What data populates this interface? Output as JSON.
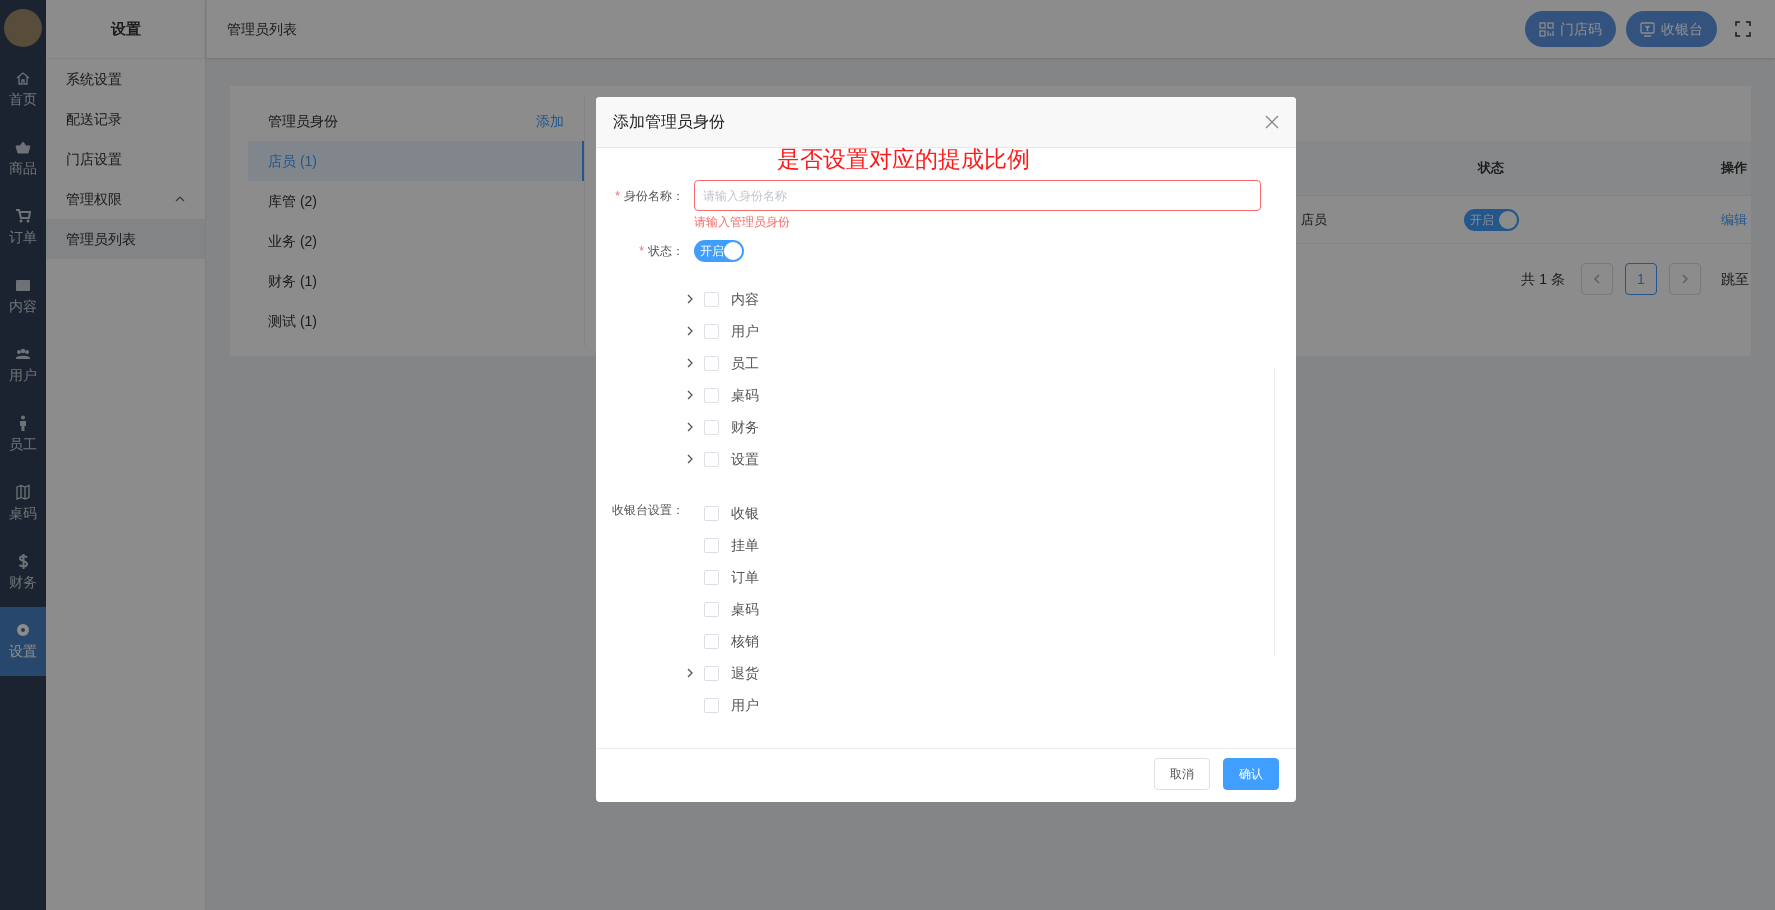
{
  "nav_rail": {
    "items": [
      {
        "label": "首页",
        "selected": false
      },
      {
        "label": "商品",
        "selected": false
      },
      {
        "label": "订单",
        "selected": false
      },
      {
        "label": "内容",
        "selected": false
      },
      {
        "label": "用户",
        "selected": false
      },
      {
        "label": "员工",
        "selected": false
      },
      {
        "label": "桌码",
        "selected": false
      },
      {
        "label": "财务",
        "selected": false
      },
      {
        "label": "设置",
        "selected": true
      }
    ]
  },
  "submenu": {
    "title": "设置",
    "items": [
      {
        "label": "系统设置"
      },
      {
        "label": "配送记录"
      },
      {
        "label": "门店设置"
      },
      {
        "label": "管理权限",
        "expanded": true,
        "children": [
          {
            "label": "管理员列表",
            "selected": true
          }
        ]
      }
    ]
  },
  "header": {
    "breadcrumb": "管理员列表",
    "buttons": [
      "门店码",
      "收银台"
    ]
  },
  "roles": {
    "title": "管理员身份",
    "add": "添加",
    "items": [
      {
        "label": "店员 (1)",
        "selected": true
      },
      {
        "label": "库管 (2)",
        "selected": false
      },
      {
        "label": "业务 (2)",
        "selected": false
      },
      {
        "label": "财务 (1)",
        "selected": false
      },
      {
        "label": "测试 (1)",
        "selected": false
      }
    ]
  },
  "table": {
    "columns": [
      "状态",
      "操作"
    ],
    "rows": [
      {
        "column_1": "店员",
        "status": {
          "label": "开启",
          "on": true
        },
        "action": "编辑"
      }
    ]
  },
  "pagination": {
    "total": "共 1 条",
    "pages": [
      {
        "label": "1",
        "selected": true
      }
    ],
    "jump": "跳至"
  },
  "dialog": {
    "title": "添加管理员身份",
    "annotation": "是否设置对应的提成比例",
    "name_field": {
      "label": "身份名称：",
      "required_mark": "*",
      "placeholder": "请输入身份名称",
      "error": "请输入管理员身份"
    },
    "status_field": {
      "label": "状态：",
      "required_mark": "*",
      "on": true,
      "text": "开启"
    },
    "permissions": [
      {
        "label": "内容",
        "expanded": false,
        "checked": false
      },
      {
        "label": "用户",
        "expanded": false,
        "checked": false
      },
      {
        "label": "员工",
        "expanded": false,
        "checked": false
      },
      {
        "label": "桌码",
        "expanded": false,
        "checked": false
      },
      {
        "label": "财务",
        "expanded": false,
        "checked": false
      },
      {
        "label": "设置",
        "expanded": false,
        "checked": false
      }
    ],
    "cashier": {
      "label": "收银台设置：",
      "items": [
        {
          "label": "收银",
          "checked": false
        },
        {
          "label": "挂单",
          "checked": false
        },
        {
          "label": "订单",
          "checked": false
        },
        {
          "label": "桌码",
          "checked": false
        },
        {
          "label": "核销",
          "checked": false
        },
        {
          "label": "退货",
          "expanded": false,
          "checked": false
        },
        {
          "label": "用户",
          "checked": false
        }
      ]
    },
    "buttons": [
      {
        "label": "取消",
        "kind": "secondary"
      },
      {
        "label": "确认",
        "kind": "primary"
      }
    ]
  }
}
